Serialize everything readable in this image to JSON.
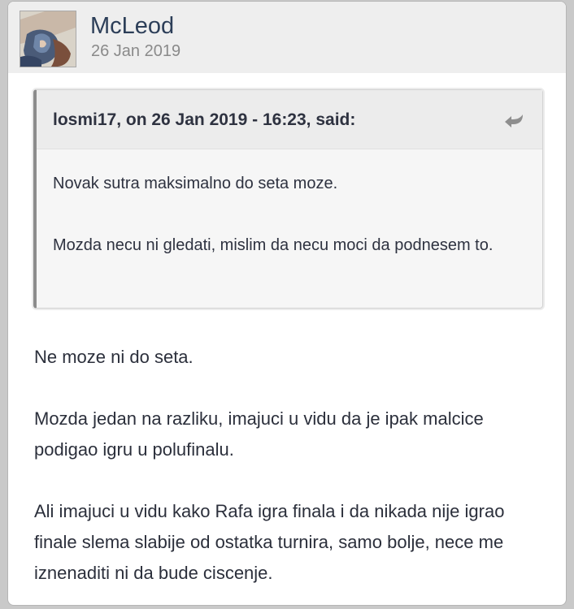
{
  "post": {
    "author": "McLeod",
    "date": "26 Jan 2019",
    "avatar": "user-avatar-image",
    "quote": {
      "citation": "losmi17, on 26 Jan 2019 - 16:23, said:",
      "snapback_icon": "snapback-arrow-icon",
      "paragraphs": [
        "Novak sutra maksimalno do seta moze.",
        "Mozda necu ni gledati, mislim da necu moci da podnesem to."
      ]
    },
    "body": {
      "paragraphs": [
        "Ne moze ni do seta.",
        "Mozda jedan na razliku, imajuci u vidu da je ipak malcice podigao igru u polufinalu.",
        "Ali imajuci u vidu kako Rafa igra finala i da nikada nije igrao finale slema slabije od ostatka turnira, samo bolje, nece me iznenaditi ni da bude ciscenje."
      ]
    }
  },
  "colors": {
    "author": "#2c3e58",
    "date": "#8a8a8a",
    "quote_border": "#8c8c8c",
    "header_bg": "#eeeeee"
  }
}
